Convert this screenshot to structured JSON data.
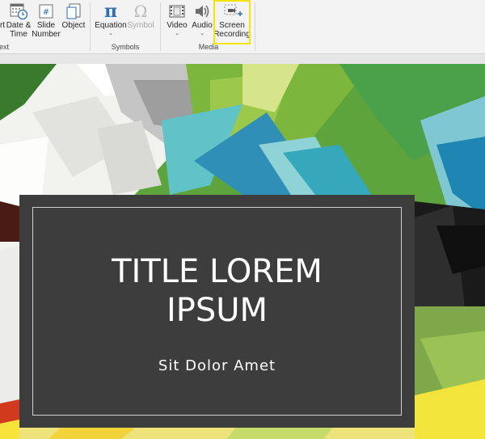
{
  "ribbon": {
    "buttons": {
      "insert_partial": "rt",
      "date_time": "Date &\nTime",
      "slide_number": "Slide\nNumber",
      "object": "Object",
      "equation": "Equation",
      "symbol": "Symbol",
      "video": "Video",
      "audio": "Audio",
      "screen_recording": "Screen\nRecording"
    },
    "dropdown_caret": "⌄",
    "groups": {
      "text_partial": "ext",
      "symbols": "Symbols",
      "media": "Media"
    },
    "icons": {
      "equation_glyph": "π",
      "symbol_glyph": "Ω"
    }
  },
  "slide": {
    "title_lines": [
      "TITLE LOREM",
      "IPSUM"
    ],
    "subtitle": "Sit Dolor Amet"
  }
}
